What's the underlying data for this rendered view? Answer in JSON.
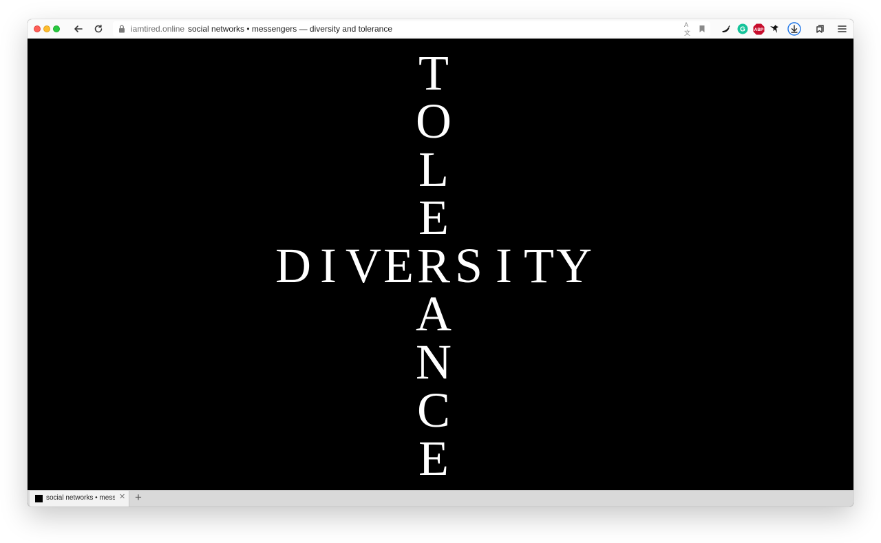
{
  "window": {
    "controls": [
      "close",
      "minimize",
      "maximize"
    ]
  },
  "toolbar": {
    "back_icon": "arrow-left-icon",
    "reload_icon": "reload-icon",
    "url": {
      "lock_icon": "lock-icon",
      "domain": "iamtired.online",
      "title": "social networks • messengers — diversity and tolerance",
      "translate_label": "A文",
      "bookmark_icon": "bookmark-icon"
    },
    "extensions": [
      {
        "name": "chili-extension-icon"
      },
      {
        "name": "grammarly-icon",
        "label": "G",
        "color": "#15c39a"
      },
      {
        "name": "adblock-plus-icon",
        "label": "ABP",
        "color": "#c70d2c"
      },
      {
        "name": "bird-extension-icon"
      },
      {
        "name": "download-icon",
        "color": "#1a73e8"
      },
      {
        "name": "tab-cycle-icon"
      },
      {
        "name": "menu-icon"
      }
    ]
  },
  "content": {
    "background": "#000000",
    "text_color": "#ffffff",
    "vertical_word": "TOLERANCE",
    "horizontal_word": "DIVERSITY"
  },
  "tabbar": {
    "tab": {
      "label": "social networks • messengers — diversity and tolerance",
      "favicon": "page-favicon-icon"
    },
    "new_tab_label": "+"
  }
}
